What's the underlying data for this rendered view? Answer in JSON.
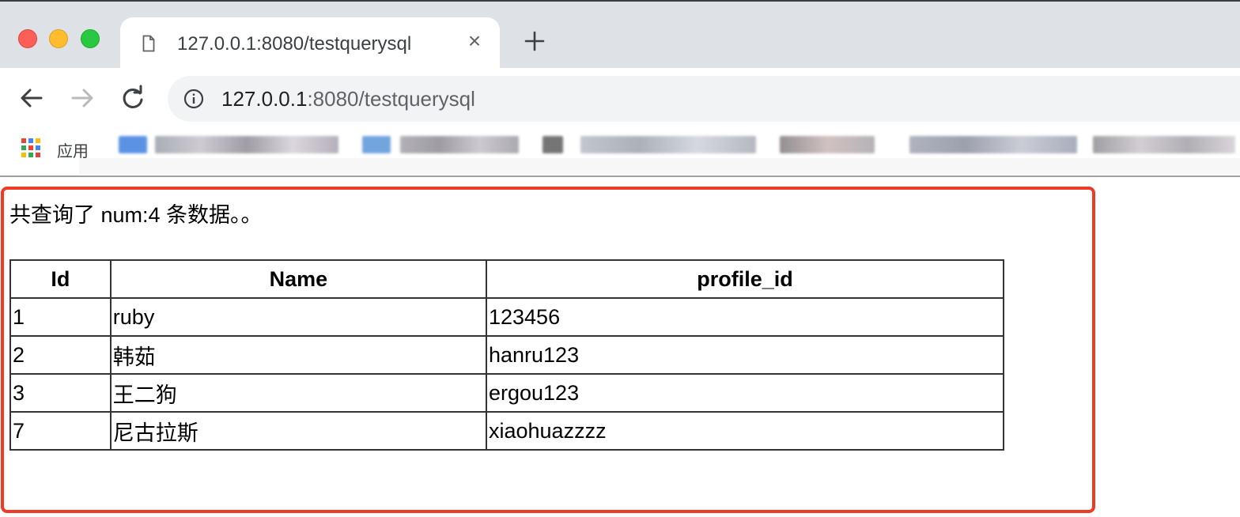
{
  "browser": {
    "tab": {
      "title": "127.0.0.1:8080/testquerysql",
      "close_glyph": "×"
    },
    "new_tab_glyph": "+",
    "address_bar": {
      "host": "127.0.0.1",
      "rest": ":8080/testquerysql"
    },
    "bookmarks": {
      "apps_label": "应用"
    },
    "colors": {
      "tabstrip": "#dee1e6",
      "omnibox": "#f1f3f4",
      "highlight_frame": "#ef3a26"
    }
  },
  "page": {
    "summary": "共查询了 num:4 条数据。。",
    "table": {
      "headers": [
        "Id",
        "Name",
        "profile_id"
      ],
      "rows": [
        [
          "1",
          "ruby",
          "123456"
        ],
        [
          "2",
          "韩茹",
          "hanru123"
        ],
        [
          "3",
          "王二狗",
          "ergou123"
        ],
        [
          "7",
          "尼古拉斯",
          "xiaohuazzzz"
        ]
      ]
    }
  }
}
